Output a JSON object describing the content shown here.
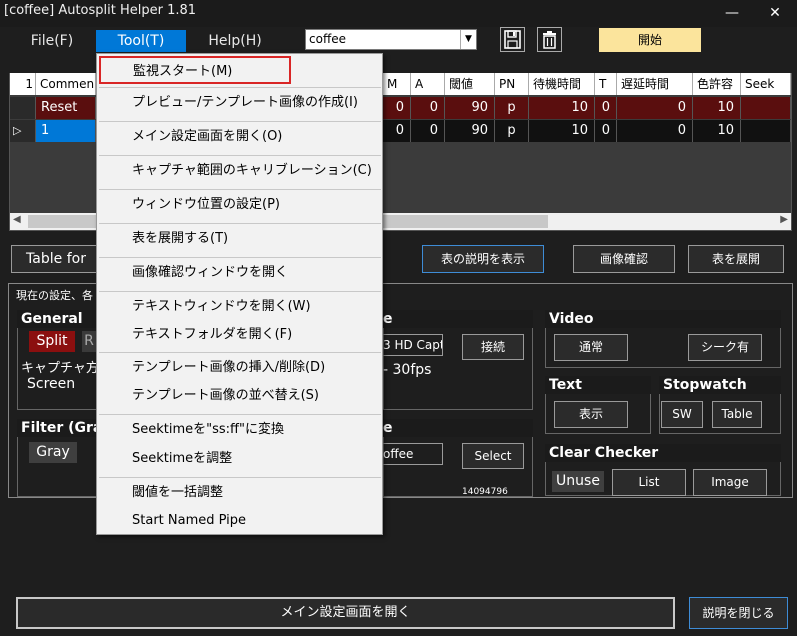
{
  "window": {
    "title": "[coffee] Autosplit Helper 1.81",
    "minimize": "—",
    "close": "✕"
  },
  "menubar": {
    "file": "File(F)",
    "tool": "Tool(T)",
    "help": "Help(H)"
  },
  "toolbar": {
    "profile_value": "coffee",
    "start_label": "開始"
  },
  "table": {
    "row_number_header": "1",
    "columns": [
      "Commen",
      "M",
      "A",
      "閾値",
      "PN",
      "待機時間",
      "T",
      "遅延時間",
      "色許容",
      "Seek"
    ],
    "rows": [
      {
        "name": "Reset",
        "m": "0",
        "a": "0",
        "threshold": "90",
        "pn": "p",
        "wait": "10",
        "t": "0",
        "delay": "0",
        "color": "10"
      },
      {
        "name": "1",
        "m": "0",
        "a": "0",
        "threshold": "90",
        "pn": "p",
        "wait": "10",
        "t": "0",
        "delay": "0",
        "color": "10"
      }
    ]
  },
  "actions": {
    "table_for": "Table for",
    "show_table_desc": "表の説明を表示",
    "image_check": "画像確認",
    "expand_table": "表を展開"
  },
  "settings": {
    "group_title": "現在の設定、各",
    "general": {
      "title": "General",
      "split": "Split",
      "r": "R",
      "capture_label": "キャプチャ方式",
      "screen": "Screen"
    },
    "device": {
      "title": "e",
      "device_value": "3 HD Capt",
      "connect": "接続",
      "fps": "- 30fps"
    },
    "video": {
      "title": "Video",
      "normal": "通常",
      "seek": "シーク有"
    },
    "text": {
      "title": "Text",
      "show": "表示"
    },
    "stopwatch": {
      "title": "Stopwatch",
      "sw": "SW",
      "table": "Table"
    },
    "filter": {
      "title": "Filter (Gra",
      "gray": "Gray"
    },
    "source": {
      "title": "e",
      "value": "offee",
      "select": "Select",
      "id": "14094796"
    },
    "clear_checker": {
      "title": "Clear Checker",
      "unuse": "Unuse",
      "list": "List",
      "image": "Image"
    }
  },
  "bottom": {
    "main_settings": "メイン設定画面を開く",
    "close_desc": "説明を閉じる"
  },
  "tool_menu": [
    "監視スタート(M)",
    "プレビュー/テンプレート画像の作成(I)",
    "メイン設定画面を開く(O)",
    "キャプチャ範囲のキャリブレーション(C)",
    "ウィンドウ位置の設定(P)",
    "表を展開する(T)",
    "画像確認ウィンドウを開く",
    "テキストウィンドウを開く(W)",
    "テキストフォルダを開く(F)",
    "テンプレート画像の挿入/削除(D)",
    "テンプレート画像の並べ替え(S)",
    "Seektimeを\"ss:ff\"に変換",
    "Seektimeを調整",
    "閾値を一括調整",
    "Start Named Pipe"
  ],
  "colors": {
    "accent": "#0078d7",
    "highlight_border": "#d92626",
    "start_button": "#fbe49c",
    "reset_row": "#5a0e0e"
  }
}
